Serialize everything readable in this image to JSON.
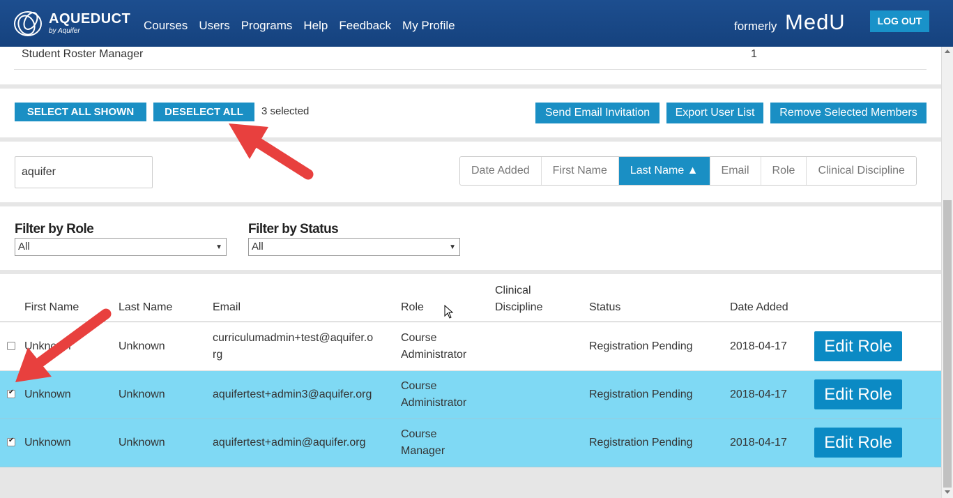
{
  "header": {
    "logo_title": "AQUEDUCT",
    "logo_sub": "by Aquifer",
    "nav": [
      "Courses",
      "Users",
      "Programs",
      "Help",
      "Feedback",
      "My Profile"
    ],
    "formerly": "formerly",
    "brand_old": "MedU",
    "logout_label": "LOG OUT"
  },
  "roster": {
    "label": "Student Roster Manager",
    "count": "1"
  },
  "actions": {
    "select_all": "SELECT ALL SHOWN",
    "deselect_all": "DESELECT ALL",
    "selected_text": "3 selected",
    "send_invite": "Send Email Invitation",
    "export": "Export User List",
    "remove": "Remove Selected Members"
  },
  "search": {
    "value": "aquifer"
  },
  "sort": {
    "options": [
      "Date Added",
      "First Name",
      "Last Name ▲",
      "Email",
      "Role",
      "Clinical Discipline"
    ],
    "active_index": 2
  },
  "filters": {
    "role_label": "Filter by Role",
    "role_value": "All",
    "status_label": "Filter by Status",
    "status_value": "All"
  },
  "table": {
    "headers": {
      "first_name": "First Name",
      "last_name": "Last Name",
      "email": "Email",
      "role": "Role",
      "clinical_1": "Clinical",
      "clinical_2": "Discipline",
      "status": "Status",
      "date_added": "Date Added"
    },
    "rows": [
      {
        "checked": false,
        "first_name": "Unknown",
        "last_name": "Unknown",
        "email_1": "curriculumadmin+test@aquifer.o",
        "email_2": "rg",
        "role_1": "Course",
        "role_2": "Administrator",
        "status": "Registration Pending",
        "date_added": "2018-04-17",
        "action": "Edit Role"
      },
      {
        "checked": true,
        "first_name": "Unknown",
        "last_name": "Unknown",
        "email_1": "aquifertest+admin3@aquifer.org",
        "email_2": "",
        "role_1": "Course",
        "role_2": "Administrator",
        "status": "Registration Pending",
        "date_added": "2018-04-17",
        "action": "Edit Role"
      },
      {
        "checked": true,
        "first_name": "Unknown",
        "last_name": "Unknown",
        "email_1": "aquifertest+admin@aquifer.org",
        "email_2": "",
        "role_1": "Course",
        "role_2": "Manager",
        "status": "Registration Pending",
        "date_added": "2018-04-17",
        "action": "Edit Role"
      }
    ]
  },
  "colors": {
    "header_bg": "#15427e",
    "accent": "#1a8fc4",
    "selected_row": "#7fd9f4",
    "annotation_arrow": "#e8403e"
  }
}
